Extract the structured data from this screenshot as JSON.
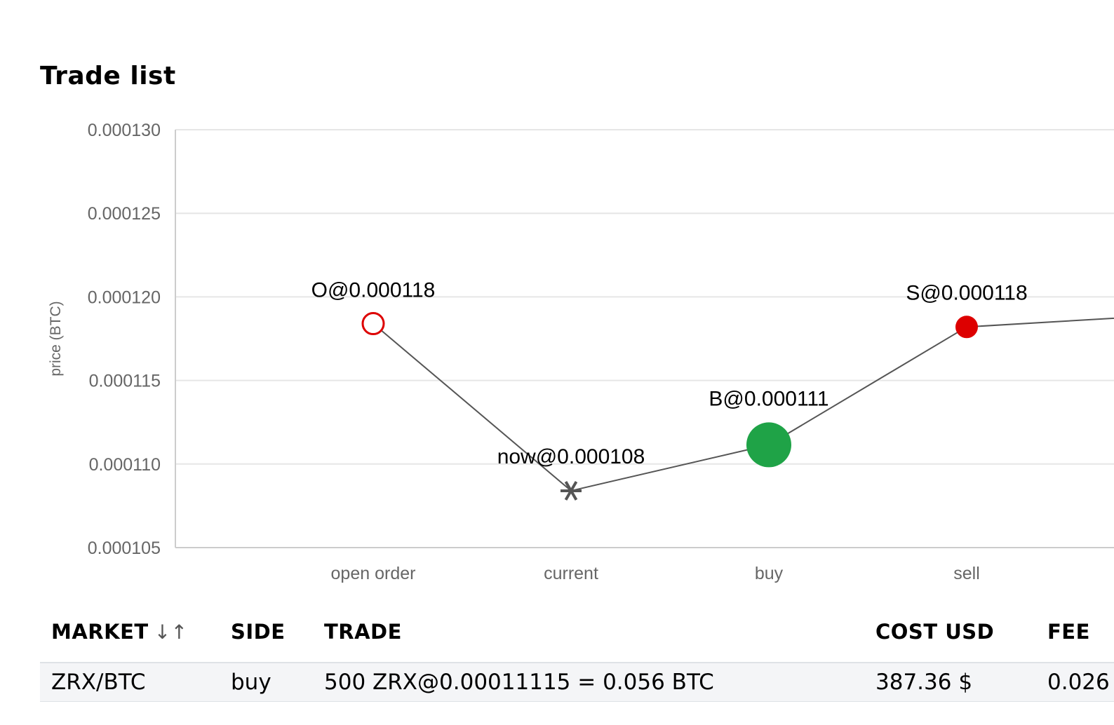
{
  "page": {
    "title": "Trade list"
  },
  "chart_data": {
    "type": "line",
    "title": "",
    "xlabel": "",
    "ylabel": "price (BTC)",
    "ylim": [
      0.000105,
      0.00013
    ],
    "yticks": [
      "0.000130",
      "0.000125",
      "0.000120",
      "0.000115",
      "0.000110",
      "0.000105"
    ],
    "grid": true,
    "categories": [
      "open order",
      "current",
      "buy",
      "sell",
      ""
    ],
    "points": [
      {
        "category": "open order",
        "value": 0.0001184,
        "label": "O@0.000118",
        "marker": "open-circle",
        "color": "#dd0000"
      },
      {
        "category": "current",
        "value": 0.0001084,
        "label": "now@0.000108",
        "marker": "asterisk",
        "color": "#555555"
      },
      {
        "category": "buy",
        "value": 0.00011115,
        "label": "B@0.000111",
        "marker": "large-circle",
        "color": "#1fa347"
      },
      {
        "category": "sell",
        "value": 0.0001182,
        "label": "S@0.000118",
        "marker": "filled-circle",
        "color": "#dd0000"
      },
      {
        "category": "",
        "value": 0.0001189,
        "label": "",
        "marker": "none",
        "color": "#555555"
      }
    ],
    "line_color": "#555555"
  },
  "table": {
    "headers": {
      "market": "MARKET",
      "side": "SIDE",
      "trade": "TRADE",
      "cost_usd": "COST USD",
      "fee": "FEE"
    },
    "sort_icon": "sort-arrows-icon",
    "sort_glyph": "↓↑",
    "rows": [
      {
        "market": "ZRX/BTC",
        "side": "buy",
        "trade": "500 ZRX@0.00011115 = 0.056 BTC",
        "cost_usd": "387.36 $",
        "fee": "0.026"
      }
    ]
  }
}
